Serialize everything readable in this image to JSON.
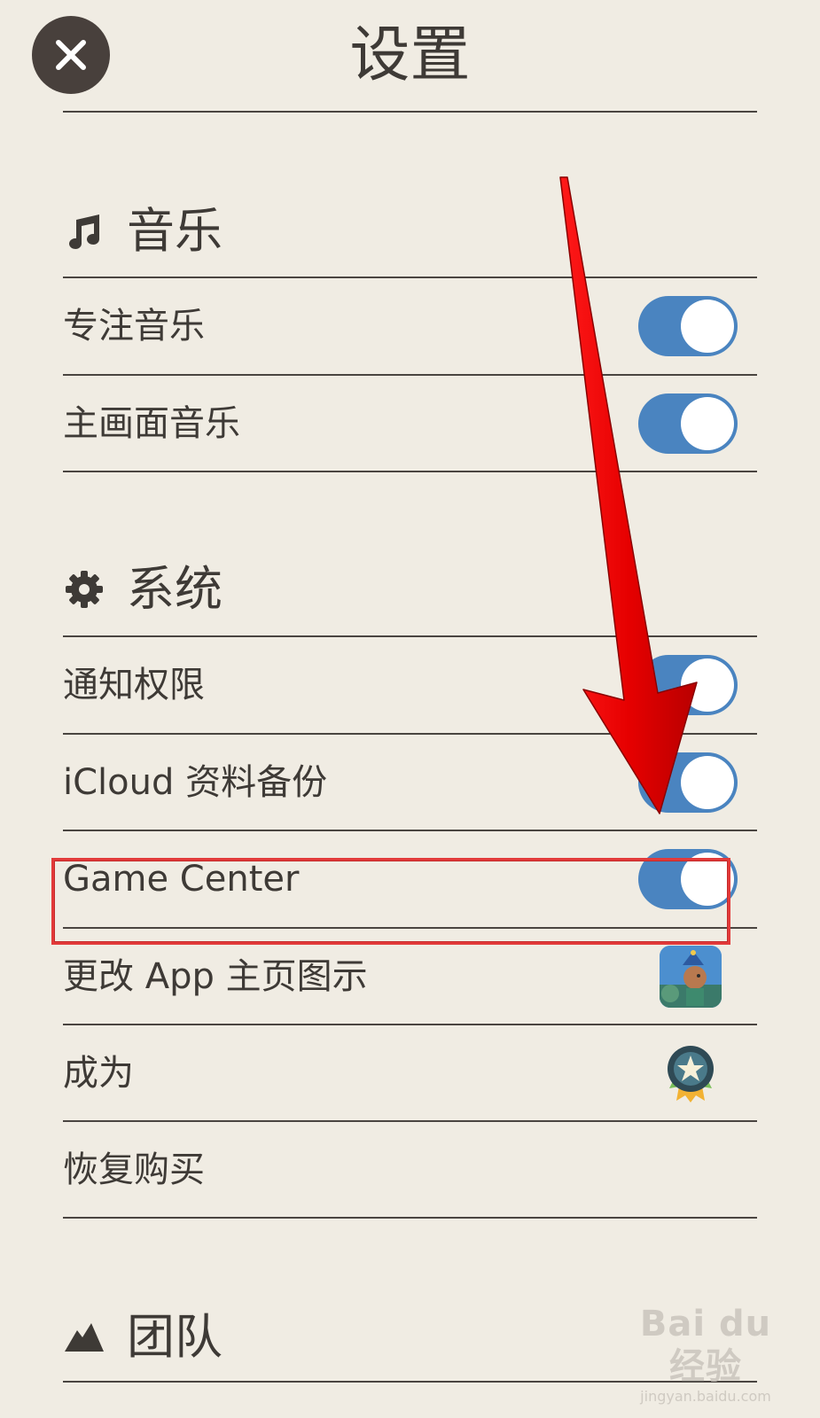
{
  "header": {
    "title": "设置"
  },
  "sections": {
    "music": {
      "title": "音乐",
      "icon": "music-note-icon",
      "rows": [
        {
          "label": "专注音乐",
          "toggle": true
        },
        {
          "label": "主画面音乐",
          "toggle": true
        }
      ]
    },
    "system": {
      "title": "系统",
      "icon": "gear-icon",
      "rows": [
        {
          "label": "通知权限",
          "toggle": true
        },
        {
          "label": "iCloud 资料备份",
          "toggle": true
        },
        {
          "label": "Game Center",
          "toggle": true,
          "highlighted": true
        },
        {
          "label": "更改 App 主页图示",
          "accessory": "app-icon-thumbnail"
        },
        {
          "label": "成为",
          "accessory": "star-badge-icon"
        },
        {
          "label": "恢复购买"
        }
      ]
    },
    "team": {
      "title": "团队",
      "icon": "mountain-icon"
    }
  },
  "colors": {
    "background": "#f0ece3",
    "text": "#3e3a36",
    "toggle_on": "#4a84c0",
    "annotation_red": "#e60000"
  },
  "watermark": {
    "main": "Bai du 经验",
    "sub": "jingyan.baidu.com"
  }
}
